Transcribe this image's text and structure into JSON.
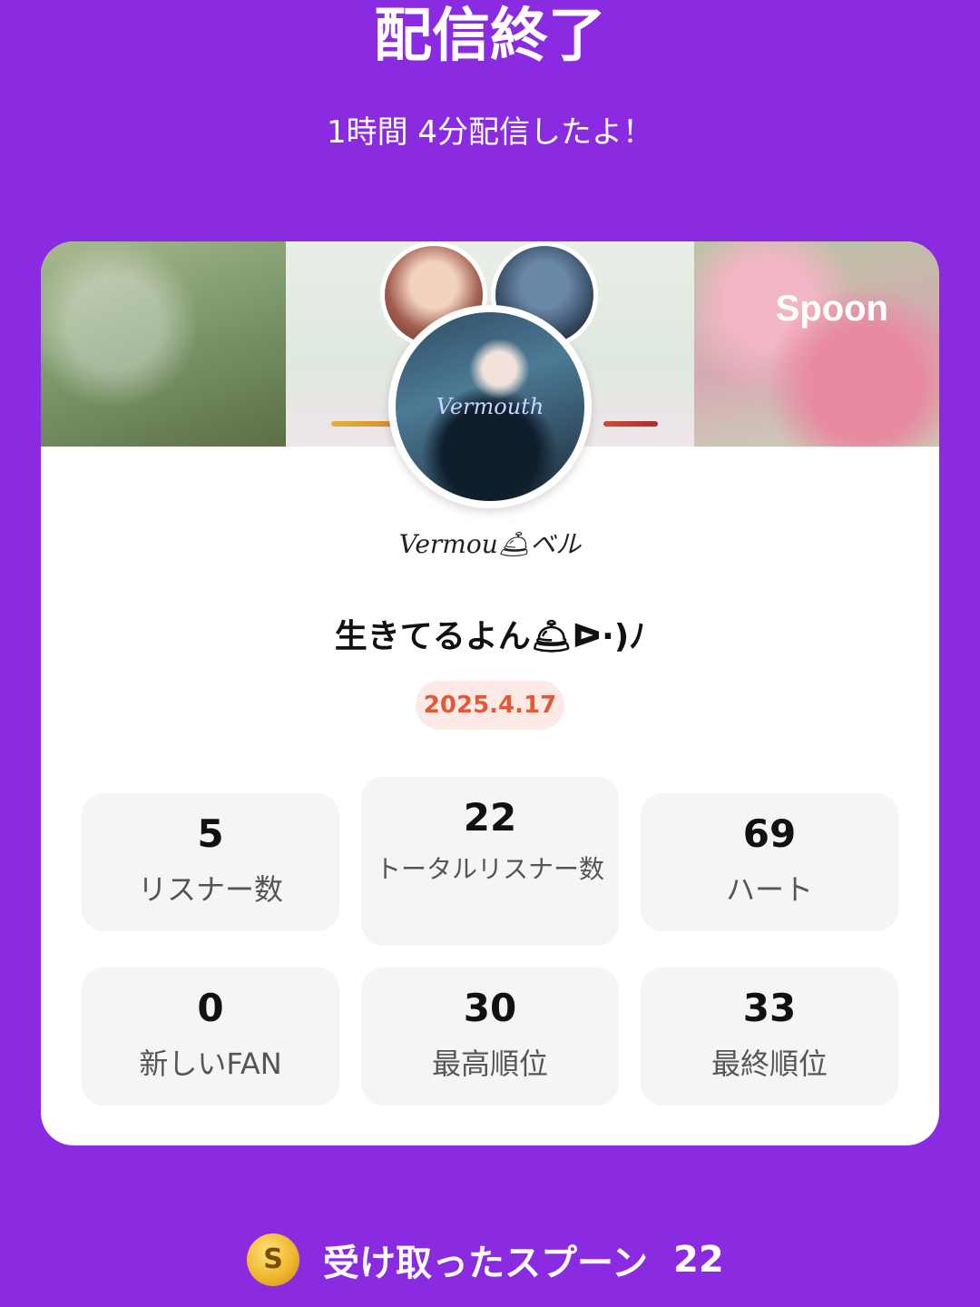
{
  "header": {
    "title": "配信終了",
    "subtitle": "1時間 4分配信したよ！"
  },
  "card": {
    "logo": "Spoon",
    "avatar_text": "Vermouth",
    "dj_name": "Vermou🛎ベル",
    "live_title": "生きてるよん🛎ᐅ·)ﾉ",
    "date": "2025.4.17",
    "stats": [
      {
        "value": "5",
        "label": "リスナー数"
      },
      {
        "value": "22",
        "label": "トータルリスナー数"
      },
      {
        "value": "69",
        "label": "ハート"
      },
      {
        "value": "0",
        "label": "新しいFAN"
      },
      {
        "value": "30",
        "label": "最高順位"
      },
      {
        "value": "33",
        "label": "最終順位"
      }
    ]
  },
  "footer": {
    "coin_symbol": "S",
    "label": "受け取ったスプーン",
    "value": "22"
  }
}
